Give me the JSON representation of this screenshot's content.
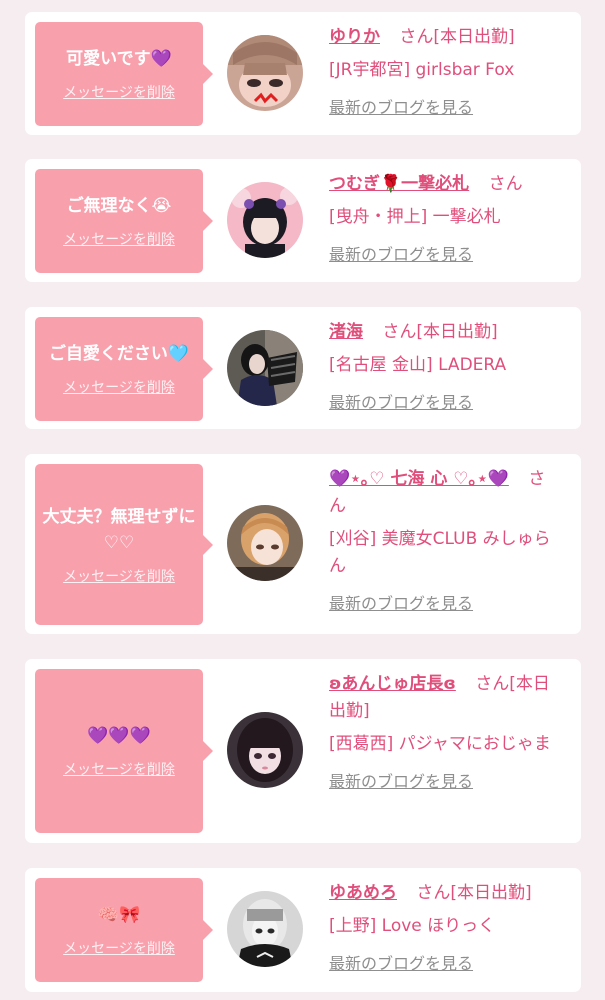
{
  "delete_label": "メッセージを削除",
  "blog_label": "最新のブログを見る",
  "san_label": "さん",
  "cards": [
    {
      "message": "可愛いです💜",
      "name": "ゆりか",
      "status": "[本日出勤]",
      "shop": "[JR宇都宮] girlsbar Fox"
    },
    {
      "message": "ご無理なく😭",
      "name": "つむぎ🌹一撃必札",
      "status": "",
      "shop": "[曳舟・押上] 一撃必札"
    },
    {
      "message": "ご自愛ください🩵",
      "name": "渚海",
      "status": "[本日出勤]",
      "shop": "[名古屋 金山] LADERA"
    },
    {
      "message": "大丈夫？無理せずに♡♡",
      "name": "💜⋆｡♡ 七海 心 ♡｡⋆💜",
      "status": "",
      "shop": "[刈谷] 美魔女CLUB みしゅらん"
    },
    {
      "message": "💜💜💜",
      "name": "ʚあんじゅ店長ɞ",
      "status": "[本日出勤]",
      "shop": "[西葛西] パジャマにおじゃま"
    },
    {
      "message": "🧠🎀",
      "name": "ゆあめろ",
      "status": "[本日出勤]",
      "shop": "[上野] Love ほりっく"
    }
  ]
}
